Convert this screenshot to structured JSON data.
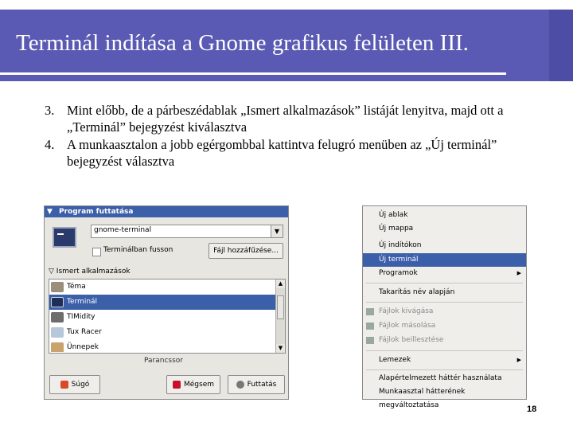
{
  "slide": {
    "title": "Terminál indítása a Gnome grafikus felületen III.",
    "page_number": "18",
    "colors": {
      "title_bg": "#5a5ab4",
      "selection": "#3b5fa8"
    }
  },
  "bullets": [
    {
      "num": "3.",
      "text": "Mint előbb, de a párbeszédablak „Ismert alkalmazások” listáját lenyitva, majd ott a „Terminál” bejegyzést kiválasztva"
    },
    {
      "num": "4.",
      "text": "A munkaasztalon a jobb egérgombbal kattintva felugró menüben az „Új terminál” bejegyzést választva"
    }
  ],
  "dialog": {
    "title": "Program futtatása",
    "menu_icon": "menu-arrow-icon",
    "command_value": "gnome-terminal",
    "run_in_terminal_label": "Terminálban fusson",
    "add_file_label": "Fájl hozzáfűzése...",
    "known_apps_label": "Ismert alkalmazások",
    "apps": [
      "Téma",
      "Terminál",
      "TIMidity",
      "Tux Racer",
      "Ünnepek"
    ],
    "selected_app": "Terminál",
    "command_label": "Parancssor",
    "help_label": "Súgó",
    "cancel_label": "Mégsem",
    "run_label": "Futtatás"
  },
  "context_menu": {
    "items": [
      {
        "label": "Új ablak"
      },
      {
        "label": "Új mappa"
      },
      {
        "label": "Új indítókon"
      },
      {
        "label": "Új terminál",
        "selected": true
      },
      {
        "label": "Programok",
        "submenu": true
      },
      {
        "label": "Takarítás név alapján"
      },
      {
        "label": "Fájlok kivágása",
        "disabled": true
      },
      {
        "label": "Fájlok másolása",
        "disabled": true
      },
      {
        "label": "Fájlok beillesztése",
        "disabled": true
      },
      {
        "label": "Lemezek",
        "submenu": true
      },
      {
        "label": "Alapértelmezett háttér használata"
      },
      {
        "label": "Munkaasztal hátterének megváltoztatása"
      }
    ]
  }
}
